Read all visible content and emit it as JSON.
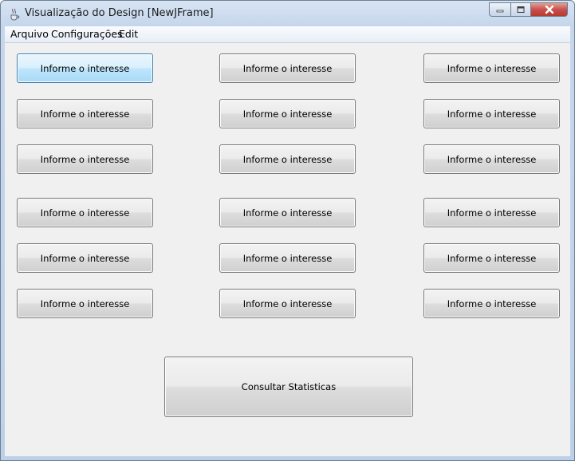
{
  "window": {
    "title": "Visualização do Design [NewJFrame]",
    "app_icon": "java-coffee-icon",
    "controls": [
      "minimize-icon",
      "maximize-icon",
      "close-icon"
    ]
  },
  "menu": {
    "items": [
      "Arquivo",
      "Configurações",
      "Edit"
    ]
  },
  "buttons": {
    "interest_label": "Informe o interesse",
    "stats_label": "Consultar Statisticas",
    "focused_index": 0
  },
  "colors": {
    "close_red": "#c75050",
    "focus_blue": "#bee6fd",
    "content_bg": "#f0f0f0"
  }
}
